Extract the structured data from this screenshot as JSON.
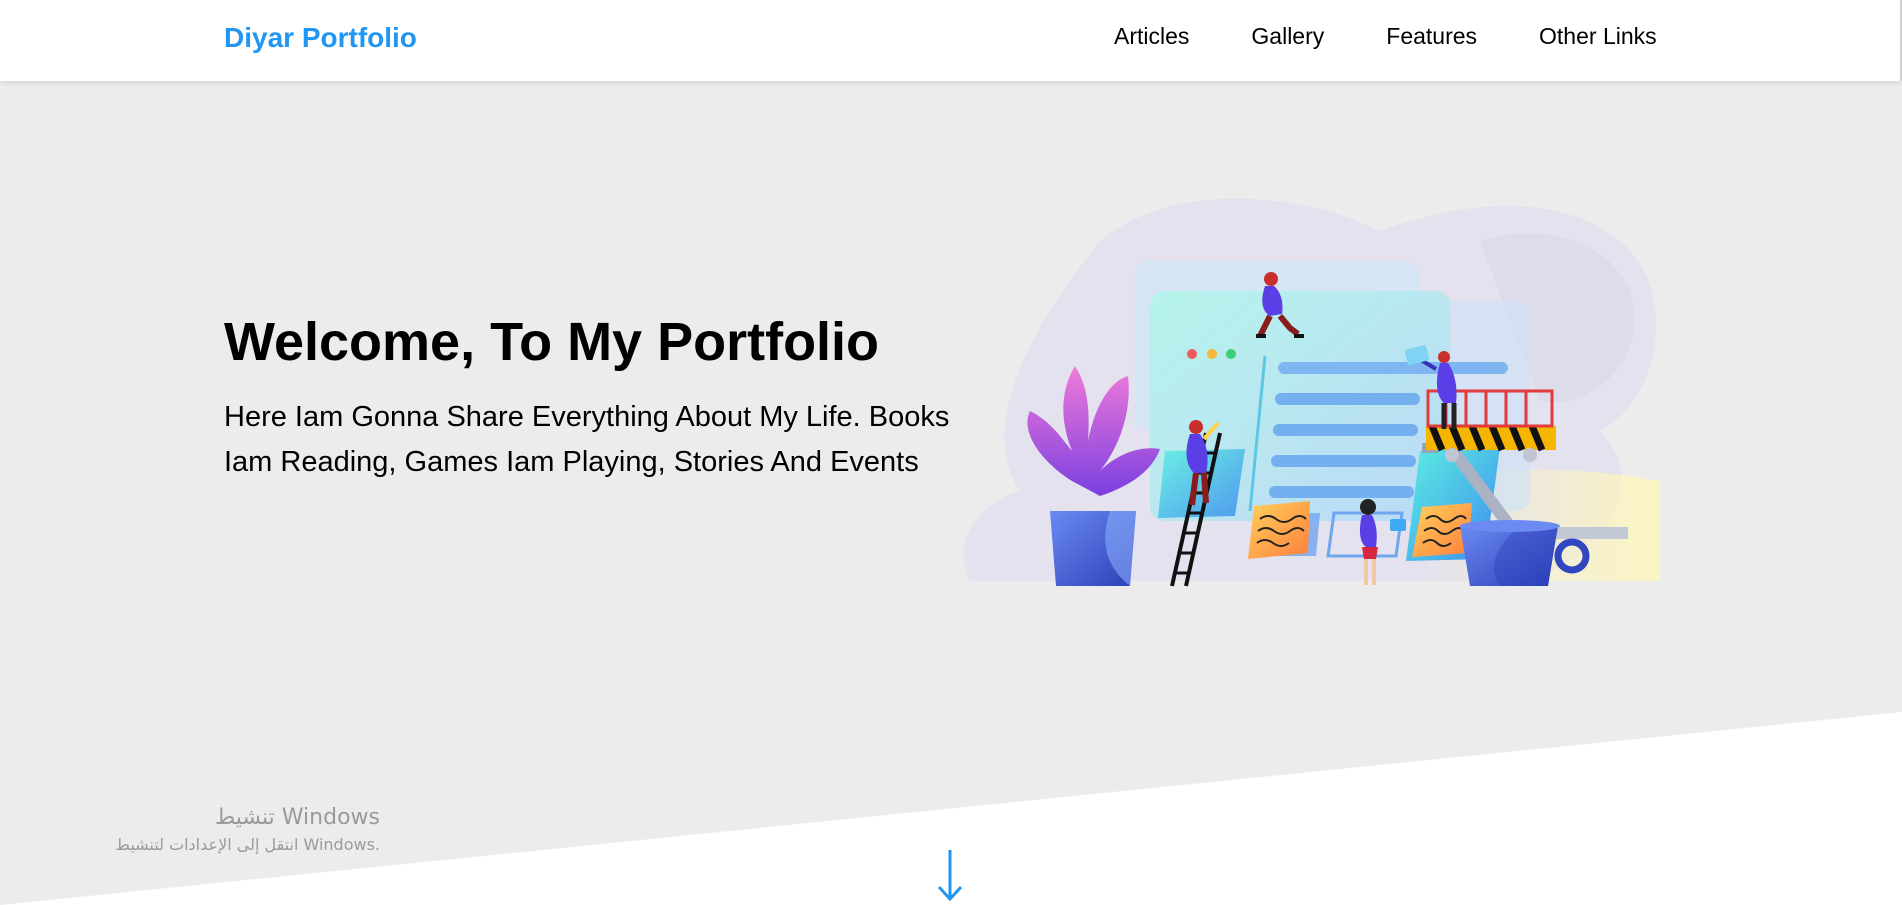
{
  "header": {
    "logo": "Diyar Portfolio",
    "nav": [
      {
        "label": "Articles"
      },
      {
        "label": "Gallery"
      },
      {
        "label": "Features"
      },
      {
        "label": "Other Links"
      }
    ]
  },
  "hero": {
    "title": "Welcome, To My Portfolio",
    "text": "Here Iam Gonna Share Everything About My Life. Books Iam Reading, Games Iam Playing, Stories And Events",
    "illustration": "team-building-website-illustration"
  },
  "scroll": {
    "icon": "arrow-down-icon"
  },
  "watermark": {
    "title": "تنشيط Windows",
    "subtitle": "انتقل إلى الإعدادات لتنشيط Windows."
  },
  "colors": {
    "brand": "#2196f3",
    "background": "#ececec",
    "header_bg": "#ffffff",
    "text": "#000000"
  }
}
